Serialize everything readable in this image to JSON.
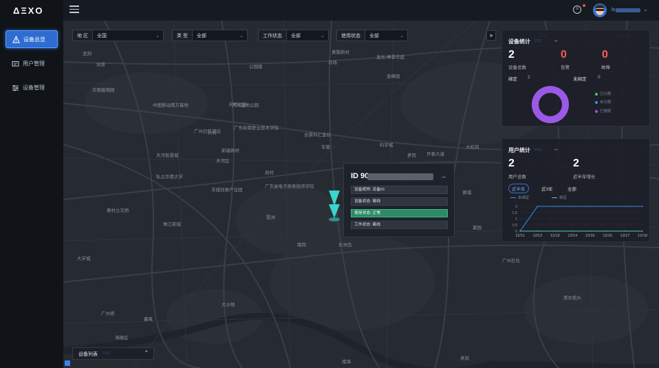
{
  "app": {
    "logo": "ΔΞXO"
  },
  "sidebar": {
    "items": [
      {
        "label": "设备总览",
        "icon": "alert-triangle-icon",
        "active": true
      },
      {
        "label": "用户管理",
        "icon": "id-card-icon",
        "active": false
      },
      {
        "label": "设备管理",
        "icon": "sliders-icon",
        "active": false
      }
    ]
  },
  "topbar": {
    "user": "lo"
  },
  "filters": [
    {
      "label": "地 区",
      "value": "全国"
    },
    {
      "label": "类 型",
      "value": "全部"
    },
    {
      "label": "工作状态",
      "value": "全部"
    },
    {
      "label": "使用状态",
      "value": "全部"
    }
  ],
  "collapse_label": "»",
  "device_stats": {
    "title": "设备统计",
    "total": "2",
    "total_label": "设备总数",
    "alarm": "0",
    "alarm_label": "告警",
    "fault": "0",
    "fault_label": "故障",
    "bound_label": "绑定",
    "bound": "2",
    "unbound_label": "未绑定",
    "unbound": "0",
    "legend": [
      {
        "label": "已分配",
        "color": "#4cc06a"
      },
      {
        "label": "未分配",
        "color": "#3d8cf0"
      },
      {
        "label": "已报废",
        "color": "#9b59e8"
      }
    ],
    "donut_color": "#9b59e8"
  },
  "user_stats": {
    "title": "用户统计",
    "total": "2",
    "total_label": "用户总数",
    "recent": "2",
    "recent_label": "近半年增长",
    "tabs": [
      "近半年",
      "近3年",
      "全部"
    ],
    "legend": [
      {
        "label": "未绑定",
        "color": "#3d8cf0"
      },
      {
        "label": "绑定",
        "color": "#4cd0b0"
      }
    ]
  },
  "chart_data": {
    "type": "line",
    "x": [
      "12/11",
      "12/12",
      "12/13",
      "12/14",
      "12/15",
      "12/16",
      "12/17",
      "12/18"
    ],
    "ylim": [
      0,
      2
    ],
    "yticks": [
      "2",
      "1.5",
      "1",
      "0.5",
      "0"
    ],
    "series": [
      {
        "name": "未绑定",
        "color": "#3d8cf0",
        "values": [
          0,
          2,
          2,
          2,
          2,
          2,
          2,
          2
        ]
      },
      {
        "name": "绑定",
        "color": "#4cd0b0",
        "values": [
          0,
          0,
          0,
          0,
          0,
          0,
          0,
          0
        ]
      }
    ]
  },
  "popup": {
    "id_prefix": "ID 90",
    "rows": [
      {
        "text": "设备昵称: 设备01",
        "highlight": false
      },
      {
        "text": "设备状态: 离线",
        "highlight": false
      },
      {
        "text": "使用状态: 正常",
        "highlight": true
      },
      {
        "text": "工作状态: 离线",
        "highlight": false
      }
    ]
  },
  "device_list": {
    "label": "设备列表"
  },
  "map_labels": [
    "龙洞",
    "天河公园",
    "公园路",
    "马场",
    "坑背",
    "黄陂新村",
    "龙光·峰景华庭",
    "天河智慧城",
    "私立华南大学",
    "黄村立交桥",
    "广东省电子商务技师学院",
    "天河区",
    "华南植物园",
    "中国移动南方基地",
    "天河湿地公园",
    "广东岭南职业技术学院",
    "火村",
    "合景科汇金谷",
    "科学城",
    "萝岗",
    "大松岗",
    "开泰大道",
    "香雪",
    "羊城创意产业园",
    "广州日航酒店",
    "新塘新村",
    "员村",
    "车陂",
    "黄埔",
    "长洲岛",
    "大学城",
    "珠江新城",
    "琶洲",
    "广州塔",
    "海珠区",
    "番禺",
    "南岗",
    "夏园",
    "大沙地",
    "广州石化",
    "美女梳头",
    "五大滨",
    "大塘",
    "大学路",
    "南海",
    "金峰园",
    "茅岗"
  ]
}
